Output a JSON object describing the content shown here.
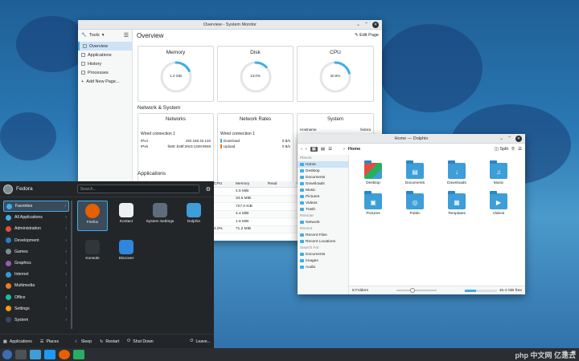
{
  "system_monitor": {
    "title": "Overview - System Monitor",
    "tools_label": "Tools",
    "nav": [
      "Overview",
      "Applications",
      "History",
      "Processes",
      "Add New Page..."
    ],
    "header": "Overview",
    "edit_page": "Edit Page",
    "cards": [
      {
        "title": "Memory",
        "value": "1.4 GiB",
        "fraction": 0.18
      },
      {
        "title": "Disk",
        "value": "13.0%",
        "fraction": 0.13
      },
      {
        "title": "CPU",
        "value": "20.6%",
        "fraction": 0.206
      }
    ],
    "network_system_heading": "Network & System",
    "networks": {
      "title": "Networks",
      "conn": "Wired connection 1",
      "ipv4_label": "IPv4",
      "ipv4": "192.168.32.132",
      "ipv6_label": "IPv6",
      "ipv6": "fe80::b48f:29c0:1328:9948"
    },
    "rates": {
      "title": "Network Rates",
      "conn": "Wired connection 1",
      "download_label": "Download",
      "download": "0 B/s",
      "upload_label": "Upload",
      "upload": "0 B/s"
    },
    "system": {
      "title": "System",
      "hostname_label": "Hostname",
      "hostname": "fedora"
    },
    "applications_heading": "Applications",
    "app_table": {
      "headers": [
        "CPU",
        "Memory",
        "Read",
        "Wri"
      ],
      "rows": [
        [
          "",
          "4.5 MiB",
          "",
          ""
        ],
        [
          "",
          "34.5 MiB",
          "",
          ""
        ],
        [
          "",
          "727.0 KiB",
          "",
          ""
        ],
        [
          "",
          "4.4 MiB",
          "",
          ""
        ],
        [
          "",
          "1.6 MiB",
          "",
          ""
        ],
        [
          "4.0%",
          "71.2 MiB",
          "",
          ""
        ]
      ]
    }
  },
  "dolphin": {
    "title": "Home — Dolphin",
    "breadcrumb": "Home",
    "split_label": "Split",
    "places_group": "Places",
    "places": [
      "Home",
      "Desktop",
      "Documents",
      "Downloads",
      "Music",
      "Pictures",
      "Videos",
      "Trash"
    ],
    "remote_group": "Remote",
    "remote": [
      "Network"
    ],
    "recent_group": "Recent",
    "recent": [
      "Recent Files",
      "Recent Locations"
    ],
    "search_group": "Search For",
    "search": [
      "Documents",
      "Images",
      "Audio"
    ],
    "folders": [
      "Desktop",
      "Documents",
      "Downloads",
      "Music",
      "Pictures",
      "Public",
      "Templates",
      "Videos"
    ],
    "status_left": "8 Folders",
    "status_right": "15.4 GiB free",
    "zoom_fraction": 0.4,
    "free_fraction": 0.35
  },
  "launcher": {
    "username": "Fedora",
    "search_placeholder": "Search...",
    "categories": [
      {
        "label": "Favorites",
        "color": "#3daee9"
      },
      {
        "label": "All Applications",
        "color": "#3daee9"
      },
      {
        "label": "Administration",
        "color": "#e74c3c"
      },
      {
        "label": "Development",
        "color": "#2980b9"
      },
      {
        "label": "Games",
        "color": "#7f8c8d"
      },
      {
        "label": "Graphics",
        "color": "#9b59b6"
      },
      {
        "label": "Internet",
        "color": "#3498db"
      },
      {
        "label": "Multimedia",
        "color": "#e67e22"
      },
      {
        "label": "Office",
        "color": "#1abc9c"
      },
      {
        "label": "Settings",
        "color": "#f39c12"
      },
      {
        "label": "System",
        "color": "#34495e"
      }
    ],
    "apps": [
      {
        "label": "Firefox",
        "color": "#e66000"
      },
      {
        "label": "Kontact",
        "color": "#ecf0f1"
      },
      {
        "label": "System Settings",
        "color": "#5d6d7e"
      },
      {
        "label": "Dolphin",
        "color": "#3d9ed8"
      },
      {
        "label": "Konsole",
        "color": "#31363b"
      },
      {
        "label": "Discover",
        "color": "#2e86de"
      }
    ],
    "bottom": {
      "applications": "Applications",
      "places": "Places",
      "sleep": "Sleep",
      "restart": "Restart",
      "shutdown": "Shut Down",
      "leave": "Leave..."
    }
  },
  "watermark": "php 中文网 亿速云"
}
